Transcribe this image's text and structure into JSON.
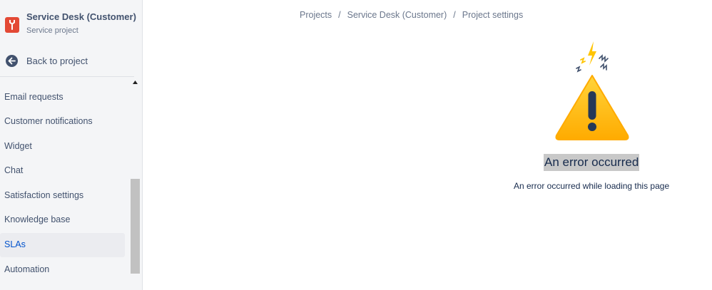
{
  "project": {
    "name": "Service Desk (Customer)",
    "type": "Service project",
    "icon": "wrench-icon",
    "icon_color": "#E34935"
  },
  "back": {
    "label": "Back to project",
    "icon": "arrow-left-circle-icon"
  },
  "sidebar": {
    "items": [
      {
        "label": "Email requests",
        "active": false
      },
      {
        "label": "Customer notifications",
        "active": false
      },
      {
        "label": "Widget",
        "active": false
      },
      {
        "label": "Chat",
        "active": false
      },
      {
        "label": "Satisfaction settings",
        "active": false
      },
      {
        "label": "Knowledge base",
        "active": false
      },
      {
        "label": "SLAs",
        "active": true
      },
      {
        "label": "Automation",
        "active": false
      }
    ]
  },
  "breadcrumb": {
    "items": [
      "Projects",
      "Service Desk (Customer)",
      "Project settings"
    ],
    "separator": "/"
  },
  "error": {
    "title": "An error occurred",
    "message": "An error occurred while loading this page",
    "illustration": "warning-triangle-icon"
  },
  "colors": {
    "accent": "#0052CC",
    "warning": "#FFAB00",
    "text": "#172B4D",
    "subtle": "#42526E"
  }
}
